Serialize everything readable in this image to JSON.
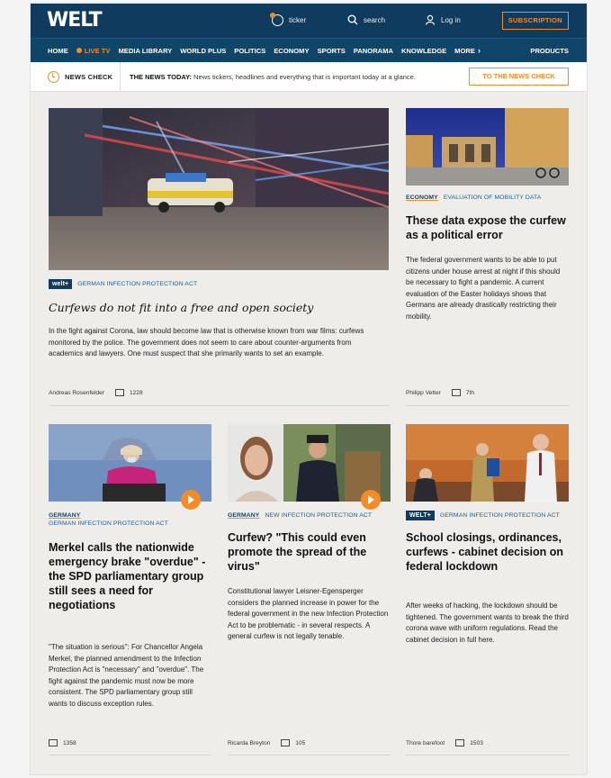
{
  "header": {
    "logo": "WELT",
    "ticker_label": "ticker",
    "search_label": "search",
    "login_label": "Log in",
    "subscription_label": "SUBSCRIPTION"
  },
  "nav": {
    "items": [
      "HOME",
      "LIVE TV",
      "MEDIA LIBRARY",
      "WORLD PLUS",
      "POLITICS",
      "ECONOMY",
      "SPORTS",
      "PANORAMA",
      "KNOWLEDGE",
      "MORE"
    ],
    "products_label": "PRODUCTS"
  },
  "newscheck": {
    "label": "NEWS CHECK",
    "today_prefix": "THE NEWS TODAY:",
    "today_text": "News tickers, headlines and everything that is important today at a glance.",
    "button_label": "TO THE NEWS CHECK"
  },
  "lead": {
    "badge": "welt+",
    "kicker": "GERMAN INFECTION PROTECTION ACT",
    "headline": "Curfews do not fit into a free and open society",
    "body": "In the fight against Corona, law should become law that is otherwise known from war films: curfews monitored by the police. The government does not seem to care about counter-arguments from academics and lawyers. One must suspect that she primarily wants to set an example.",
    "author": "Andreas Rosenfelder",
    "comments": "1228"
  },
  "side": {
    "category": "ECONOMY",
    "kicker": "EVALUATION OF MOBILITY DATA",
    "headline": "These data expose the curfew as a political error",
    "body": "The federal government wants to be able to put citizens under house arrest at night if this should be necessary to fight a pandemic. A current evaluation of the Easter holidays shows that Germans are already drastically restricting their mobility.",
    "author": "Philipp Vetter",
    "comments": "7th"
  },
  "cards": [
    {
      "category": "GERMANY",
      "kicker": "GERMAN INFECTION PROTECTION ACT",
      "headline": "Merkel calls the nationwide emergency brake \"overdue\" - the SPD parliamentary group still sees a need for negotiations",
      "body": "\"The situation is serious\": For Chancellor Angela Merkel, the planned amendment to the Infection Protection Act is \"necessary\" and \"overdue\". The fight against the pandemic must now be more consistent. The SPD parliamentary group still wants to discuss exception rules.",
      "author": "",
      "comments": "1358"
    },
    {
      "category": "GERMANY",
      "kicker": "NEW INFECTION PROTECTION ACT",
      "headline": "Curfew? \"This could even promote the spread of the virus\"",
      "body": "Constitutional lawyer Leisner-Egensperger considers the planned increase in power for the federal government in the new Infection Protection Act to be problematic - in several respects. A general curfew is not legally tenable.",
      "author": "Ricarda Breyton",
      "comments": "105"
    },
    {
      "badge": "WELT+",
      "kicker": "GERMAN INFECTION PROTECTION ACT",
      "headline": "School closings, ordinances, curfews - cabinet decision on federal lockdown",
      "body": "After weeks of hacking, the lockdown should be tightened. The government wants to break the third corona wave with uniform regulations. Read the cabinet decision in full here.",
      "author": "Thore barefoot",
      "comments": "1503"
    }
  ],
  "colors": {
    "navy": "#0e3b5e",
    "accent": "#f28c28",
    "background": "#efedea"
  }
}
